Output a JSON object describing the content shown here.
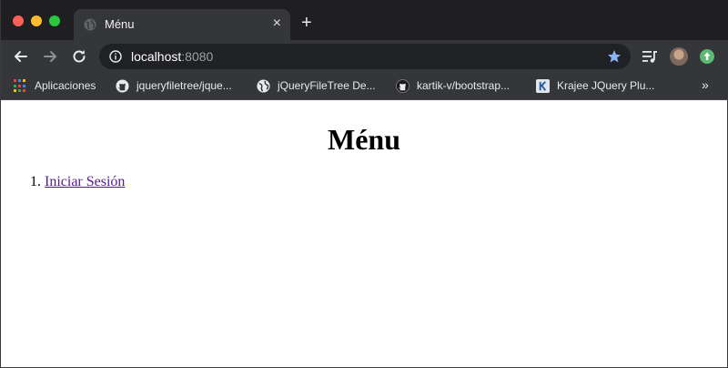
{
  "browser": {
    "tab": {
      "title": "Ménu",
      "close_symbol": "×"
    },
    "new_tab_symbol": "+",
    "address": {
      "host": "localhost",
      "port": ":8080"
    },
    "bookmarks": [
      {
        "label": "Aplicaciones",
        "icon": "apps-grid-icon"
      },
      {
        "label": "jqueryfiletree/jque...",
        "icon": "github-icon"
      },
      {
        "label": "jQueryFileTree De...",
        "icon": "globe-icon"
      },
      {
        "label": "kartik-v/bootstrap...",
        "icon": "github-icon"
      },
      {
        "label": "Krajee JQuery Plu...",
        "icon": "krajee-k-icon"
      }
    ],
    "more_bookmarks_symbol": "»"
  },
  "page": {
    "title": "Ménu",
    "menu_items": [
      {
        "number": "1.",
        "label": "Iniciar Sesión"
      }
    ]
  },
  "colors": {
    "tab_strip": "#1f1f21",
    "toolbar": "#35363a",
    "omnibox": "#202124",
    "star_accent": "#8ab4f8",
    "visited_link": "#551a8b"
  }
}
